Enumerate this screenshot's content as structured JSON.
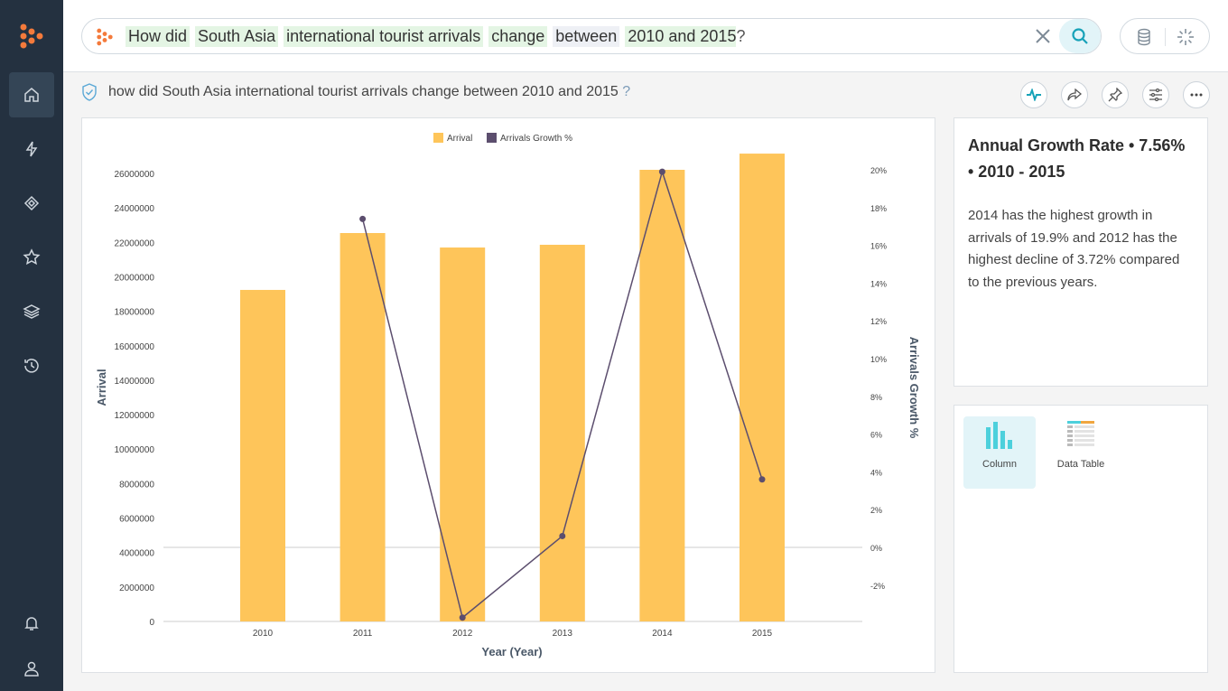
{
  "search": {
    "tokens": [
      {
        "text": "How did",
        "style": "green"
      },
      {
        "text": "South Asia",
        "style": "green"
      },
      {
        "text": "international tourist arrivals",
        "style": "green"
      },
      {
        "text": "change",
        "style": "green"
      },
      {
        "text": "between",
        "style": "grey"
      },
      {
        "text": "2010 and 2015",
        "style": "green"
      }
    ],
    "suffix": "?"
  },
  "query_line": {
    "text": "how did South Asia international tourist arrivals change between 2010 and 2015",
    "suffix": "?"
  },
  "sidebar": {
    "items": [
      "home-icon",
      "bolt-icon",
      "diamond-icon",
      "star-icon",
      "layers-icon",
      "history-icon",
      "bell-icon",
      "user-icon"
    ]
  },
  "actions": [
    "pulse-icon",
    "share-icon",
    "pin-icon",
    "settings-icon",
    "more-icon"
  ],
  "insight": {
    "title": "Annual Growth Rate • 7.56% • 2010 - 2015",
    "text": "2014 has the highest growth in arrivals of 19.9% and 2012 has the highest decline of 3.72% compared to the previous years."
  },
  "viz_types": [
    {
      "label": "Column",
      "selected": true
    },
    {
      "label": "Data Table",
      "selected": false
    }
  ],
  "colors": {
    "bar": "#fec55a",
    "line": "#5c4e6e",
    "accent": "#17a2b8",
    "sidebar": "#243140"
  },
  "chart_data": {
    "type": "bar+line",
    "categories": [
      "2010",
      "2011",
      "2012",
      "2013",
      "2014",
      "2015"
    ],
    "series": [
      {
        "name": "Arrival",
        "type": "bar",
        "axis": "left",
        "values": [
          19240000,
          22540000,
          21700000,
          21860000,
          26210000,
          27150000
        ]
      },
      {
        "name": "Arrivals Growth %",
        "type": "line",
        "axis": "right",
        "values": [
          null,
          17.4,
          -3.72,
          0.6,
          19.9,
          3.6
        ]
      }
    ],
    "xlabel": "Year (Year)",
    "ylabel": "Arrival",
    "y2label": "Arrivals Growth %",
    "yticks": [
      "0",
      "2000000",
      "4000000",
      "6000000",
      "8000000",
      "10000000",
      "12000000",
      "14000000",
      "16000000",
      "18000000",
      "20000000",
      "22000000",
      "24000000",
      "26000000"
    ],
    "y2ticks": [
      "-2%",
      "0%",
      "2%",
      "4%",
      "6%",
      "8%",
      "10%",
      "12%",
      "14%",
      "16%",
      "18%",
      "20%"
    ],
    "ylim": [
      0,
      26000000
    ],
    "y2lim": [
      -3.9,
      20
    ],
    "legend": "top"
  }
}
